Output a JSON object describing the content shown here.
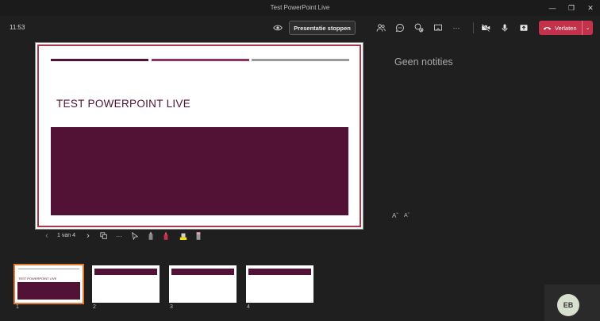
{
  "window": {
    "title": "Test PowerPoint Live",
    "minimize_glyph": "—",
    "restore_glyph": "❐",
    "close_glyph": "✕"
  },
  "toolbar": {
    "clock": "11:53",
    "stop_label": "Presentatie stoppen",
    "leave_label": "Verlaten",
    "more_glyph": "···",
    "leave_chevron": "⌄"
  },
  "slide": {
    "title": "TEST POWERPOINT LIVE",
    "accent_dark": "#511236",
    "accent_mid": "#8f3460",
    "accent_gray": "#9a9a9a"
  },
  "notes": {
    "empty_text": "Geen notities",
    "font_increase": "Aˆ",
    "font_decrease": "Aˇ"
  },
  "navigation": {
    "prev_glyph": "‹",
    "page_indicator": "1 van 4",
    "next_glyph": "›",
    "more_glyph": "···"
  },
  "thumbnails": [
    {
      "number": "1",
      "title": "TEST POWERPOINT LIVE",
      "active": true
    },
    {
      "number": "2",
      "title": "",
      "active": false
    },
    {
      "number": "3",
      "title": "",
      "active": false
    },
    {
      "number": "4",
      "title": "",
      "active": false
    }
  ],
  "participant": {
    "initials": "EB"
  }
}
